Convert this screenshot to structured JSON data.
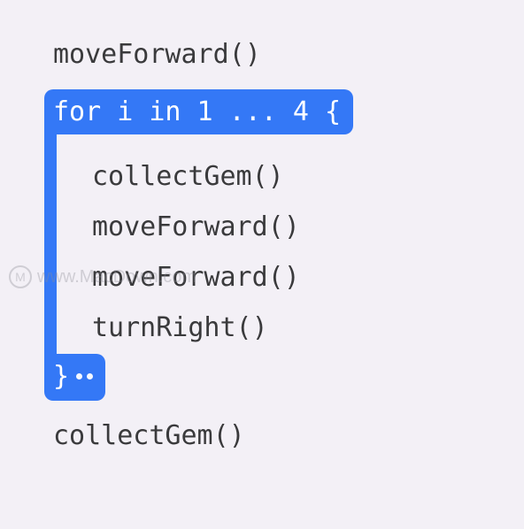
{
  "code": {
    "line1": "moveForward()",
    "for_header": "for i in 1 ... 4 {",
    "for_body": [
      "collectGem()",
      "moveForward()",
      "moveForward()",
      "turnRight()"
    ],
    "for_footer_brace": "}",
    "line_last": "collectGem()"
  },
  "colors": {
    "highlight": "#3478f6",
    "background": "#f3f0f6",
    "text": "#3a3a3c"
  },
  "watermark": {
    "badge": "M",
    "text": "www.MacDown.com"
  }
}
